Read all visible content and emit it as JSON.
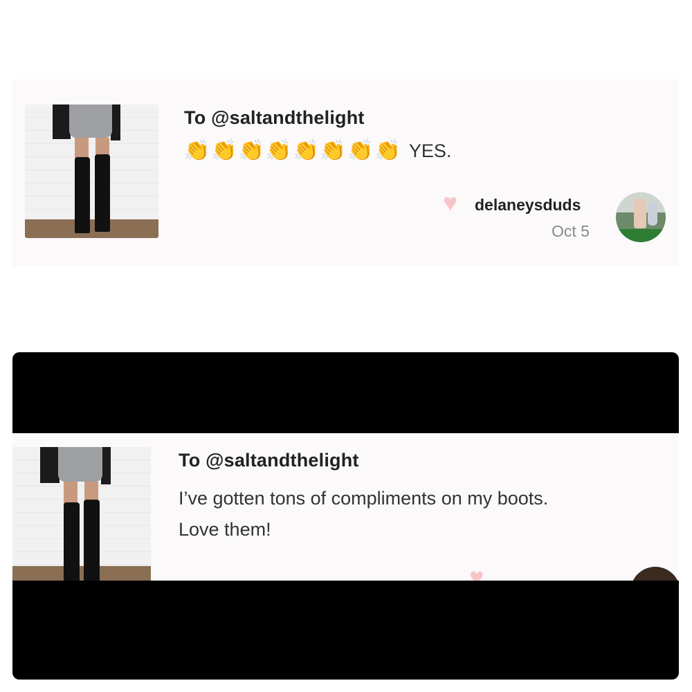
{
  "comment1": {
    "recipient": "To @saltandthelight",
    "claps": [
      "👏",
      "👏",
      "👏",
      "👏",
      "👏",
      "👏",
      "👏",
      "👏"
    ],
    "message": "YES.",
    "username": "delaneysduds",
    "date": "Oct 5"
  },
  "comment2": {
    "recipient": "To @saltandthelight",
    "message_line1": "I’ve gotten tons of compliments on my boots.",
    "message_line2": "Love them!"
  },
  "icons": {
    "heart": "heart-icon",
    "clap": "clapping-hands-emoji"
  },
  "colors": {
    "card_bg": "#fbf9fa",
    "heart": "#f7c5c8",
    "date": "#8a8a8a",
    "frame_bg": "#000000"
  }
}
